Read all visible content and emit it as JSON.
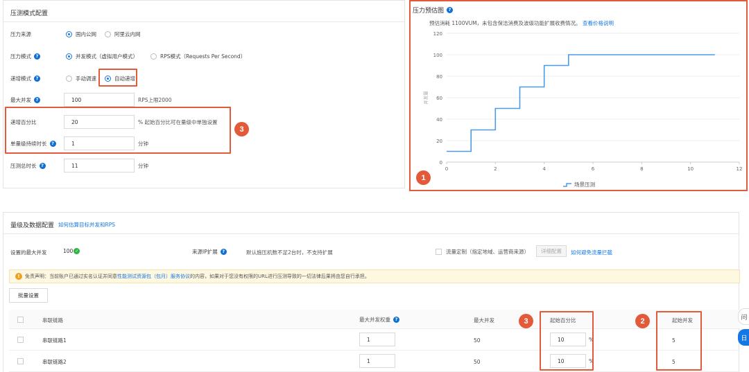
{
  "config": {
    "title": "压测模式配置",
    "source": {
      "label": "压力来源",
      "options": [
        "国内公网",
        "阿里云内网"
      ],
      "selected": 0
    },
    "mode": {
      "label": "压力模式",
      "options": [
        "并发模式（虚拟用户模式）",
        "RPS模式（Requests Per Second）"
      ],
      "selected": 0
    },
    "ramp": {
      "label": "递增模式",
      "options": [
        "手动调速",
        "自动递增"
      ],
      "selected": 1
    },
    "max_concurrency": {
      "label": "最大并发",
      "value": "100",
      "suffix": "RPS上限2000"
    },
    "ramp_percent": {
      "label": "递增百分比",
      "value": "20",
      "suffix": "% 起始百分比可在量级中单独设置"
    },
    "step_duration": {
      "label": "单量级持续时长",
      "value": "1",
      "suffix": "分钟"
    },
    "total_duration": {
      "label": "压测总时长",
      "value": "11",
      "suffix": "分钟"
    }
  },
  "estimate": {
    "title": "压力预估图",
    "note": "预估消耗 1100VUM，未包含保洁消费及波级功能扩展收费情况。",
    "note_link": "查看价格说明",
    "legend": "场景压测"
  },
  "chart_data": {
    "type": "line",
    "ylabel": "并发量",
    "x_ticks": [
      0,
      2,
      4,
      6,
      8,
      10,
      12
    ],
    "y_ticks": [
      0,
      20,
      40,
      60,
      80,
      100,
      120
    ],
    "xlim": [
      0,
      12
    ],
    "ylim": [
      0,
      120
    ],
    "step": true,
    "series": [
      {
        "name": "场景压测",
        "x": [
          0,
          1,
          1,
          2,
          2,
          3,
          3,
          4,
          4,
          5,
          5,
          11
        ],
        "y": [
          10,
          10,
          30,
          30,
          50,
          50,
          70,
          70,
          90,
          90,
          100,
          100
        ]
      }
    ],
    "color": "#4a9be8"
  },
  "levels": {
    "title": "量级及数据配置",
    "title_link": "如何估算目标并发和RPS",
    "max_label": "设置的最大并发",
    "max_value": "100",
    "scale_label": "来源IP扩展",
    "scale_text": "默认施压机数不足2台时，不支持扩展",
    "traffic_label": "流量定制（指定地域、运营商来源）",
    "detail_btn": "详细配置",
    "avoid_link": "如何避免流量拦截",
    "notice_prefix": "免责声明：当前账户已通过实名认证并同意",
    "notice_link": "性能测试资源包（包月）服务协议",
    "notice_suffix": "的内容，如果对于您没有权限的URL进行压测导致的一切法律后果将由您自行承担。",
    "batch_btn": "批量设置",
    "columns": [
      "串联链路",
      "最大并发权重",
      "最大并发",
      "起始百分比",
      "起始并发"
    ],
    "rows": [
      {
        "name": "串联链路1",
        "weight": "1",
        "max": "50",
        "start_pct": "10",
        "start": "5"
      },
      {
        "name": "串联链路2",
        "weight": "1",
        "max": "50",
        "start_pct": "10",
        "start": "5"
      }
    ],
    "pct_unit": "%"
  },
  "badges": [
    "1",
    "2",
    "3",
    "3"
  ],
  "side": {
    "a": "问",
    "b": "日"
  },
  "colors": {
    "accent": "#1477e6",
    "highlight": "#e35a3a",
    "ok": "#2fb344",
    "warn_bg": "#fff8e1"
  }
}
